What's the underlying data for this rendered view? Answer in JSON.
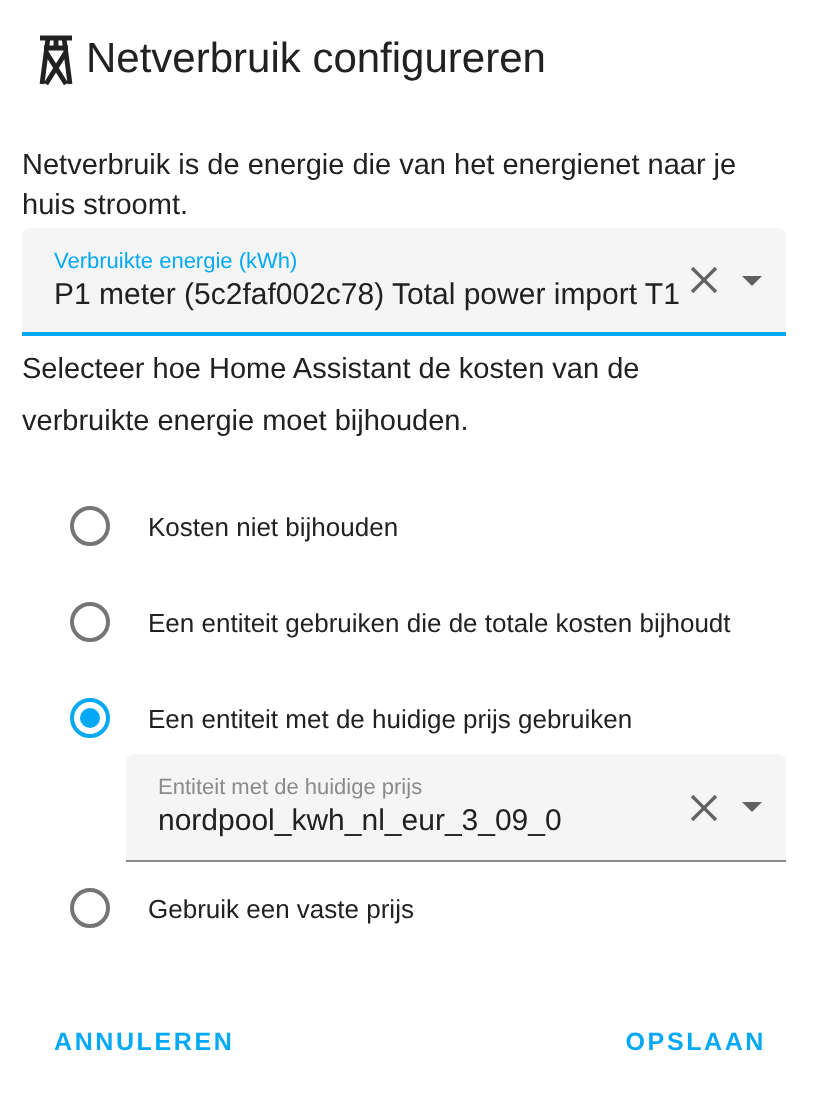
{
  "dialog": {
    "title": "Netverbruik configureren",
    "description": "Netverbruik is de energie die van het energienet naar je huis stroomt.",
    "energy_field": {
      "label": "Verbruikte energie (kWh)",
      "value": "P1 meter (5c2faf002c78) Total power import T1",
      "focused": true
    },
    "cost_prompt": "Selecteer hoe Home Assistant de kosten van de verbruikte energie moet bijhouden.",
    "cost_options": [
      {
        "label": "Kosten niet bijhouden",
        "selected": false
      },
      {
        "label": "Een entiteit gebruiken die de totale kosten bijhoudt",
        "selected": false
      },
      {
        "label": "Een entiteit met de huidige prijs gebruiken",
        "selected": true,
        "field": {
          "label": "Entiteit met de huidige prijs",
          "value": "nordpool_kwh_nl_eur_3_09_0",
          "focused": false
        }
      },
      {
        "label": "Gebruik een vaste prijs",
        "selected": false
      }
    ],
    "buttons": [
      {
        "label": "ANNULEREN"
      },
      {
        "label": "OPSLAAN"
      }
    ]
  }
}
